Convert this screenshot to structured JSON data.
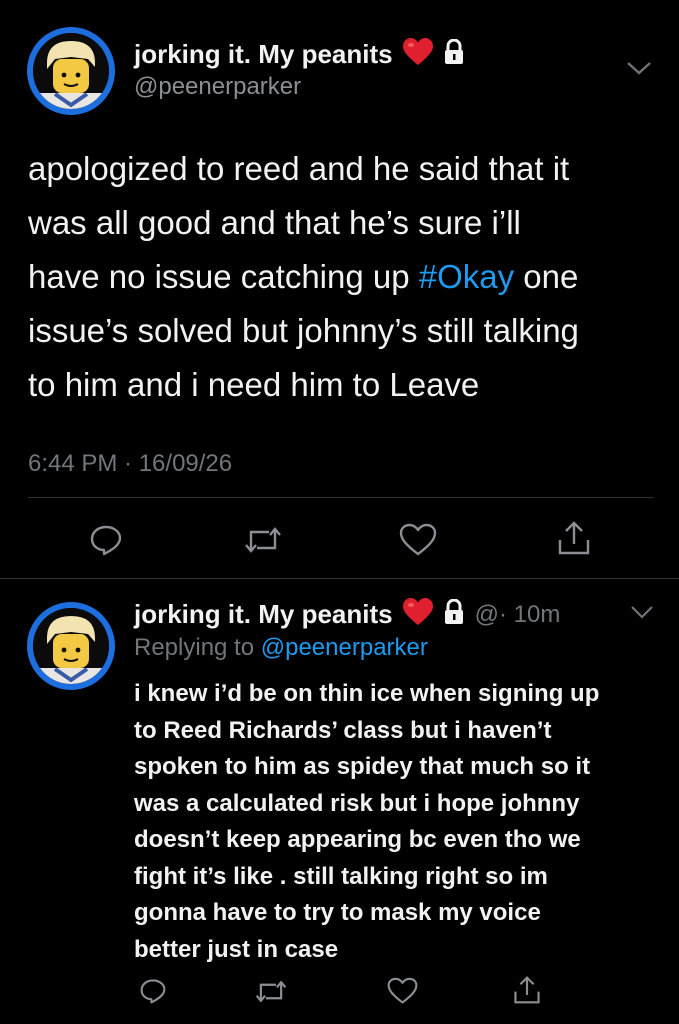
{
  "main_tweet": {
    "display_name": "jorking it.  My peanits",
    "heart": "❤️",
    "handle": "@peenerparker",
    "text_lines": [
      "apologized to reed and he said that it",
      "was all good and that he’s sure i’ll",
      "have no issue catching up ",
      "issue’s solved but johnny’s still talking",
      "to him and i need him to Leave"
    ],
    "hashtag": "#Okay",
    "after_hashtag": " one",
    "timestamp": "6:44 PM · 16/09/26"
  },
  "reply_tweet": {
    "display_name": "jorking it.  My peanits",
    "heart": "❤️",
    "meta": "@· 10m",
    "replying_prefix": "Replying to ",
    "replying_to": "@peenerparker",
    "text_lines": [
      "i knew i’d be on thin ice when signing up",
      "to Reed Richards’ class but i haven’t",
      "spoken to him as spidey that much so it",
      "was a calculated risk but i hope johnny",
      "doesn’t keep appearing bc even tho we",
      "fight it’s like . still talking right so im",
      "gonna have to try to mask my voice",
      "better just in case"
    ]
  },
  "icons": {
    "avatar": "lego-minifig-avatar",
    "verified": "lock-icon",
    "menu": "chevron-down-icon",
    "reply": "reply-icon",
    "retweet": "retweet-icon",
    "like": "heart-icon",
    "share": "share-icon"
  },
  "colors": {
    "background": "#000000",
    "text": "#f2f2f2",
    "secondary": "#71767b",
    "accent": "#1d9bf0",
    "avatar_ring": "#1d6fe0"
  }
}
